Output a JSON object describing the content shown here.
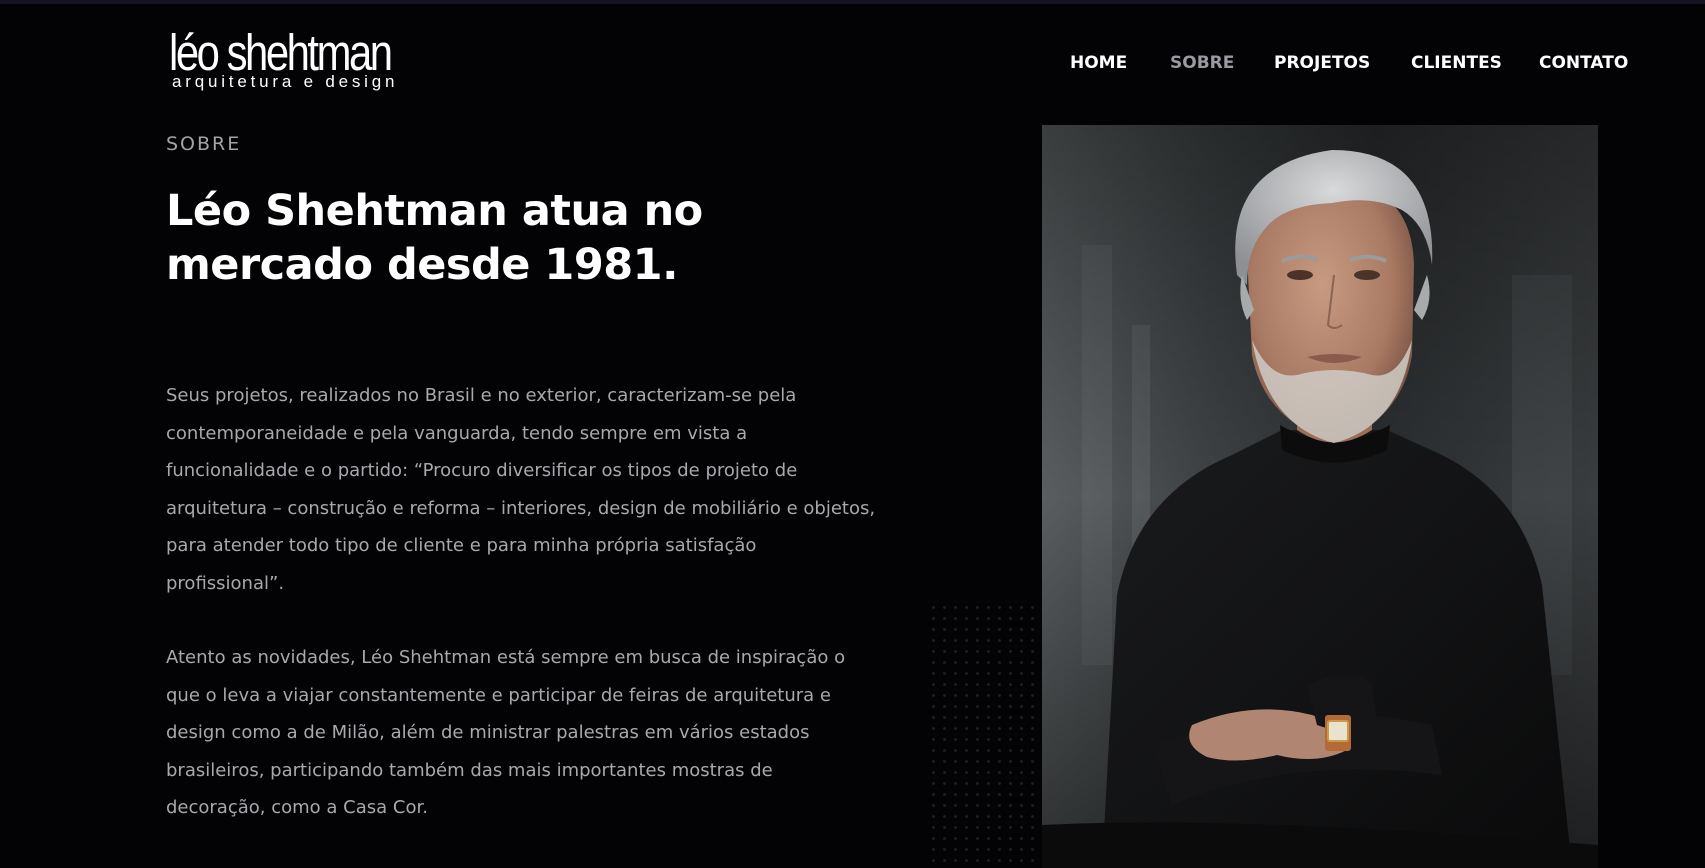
{
  "header": {
    "logo": {
      "name": "léo shehtman",
      "tagline": "arquitetura e design"
    },
    "nav": [
      {
        "label": "HOME",
        "active": false
      },
      {
        "label": "SOBRE",
        "active": true
      },
      {
        "label": "PROJETOS",
        "active": false
      },
      {
        "label": "CLIENTES",
        "active": false
      },
      {
        "label": "CONTATO",
        "active": false
      }
    ]
  },
  "about": {
    "label": "SOBRE",
    "headline": "Léo Shehtman atua no mercado desde 1981.",
    "paragraphs": [
      "Seus projetos, realizados no Brasil e no exterior, caracterizam-se pela contemporaneidade e pela vanguarda, tendo sempre em vista a funcionalidade e o partido: “Procuro diversificar os tipos de projeto de arquitetura – construção e reforma – interiores, design de mobiliário e objetos, para atender todo tipo de cliente e para minha própria satisfação profissional”.",
      "Atento as novidades, Léo Shehtman está sempre em busca de inspiração o que o leva a viajar constantemente e participar de feiras de arquitetura e design como a de Milão, além de ministrar palestras em vários estados brasileiros, participando também das mais importantes mostras de decoração, como a Casa Cor."
    ]
  },
  "colors": {
    "background": "#030305",
    "text_primary": "#ffffff",
    "text_muted": "#a8a8ad",
    "nav_active": "#9a9aa0"
  }
}
